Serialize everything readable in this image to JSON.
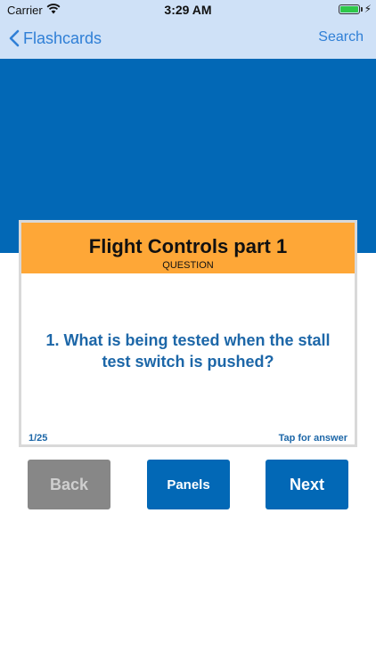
{
  "status_bar": {
    "carrier": "Carrier",
    "time": "3:29 AM",
    "battery_level": 1.0
  },
  "nav": {
    "back_label": "Flashcards",
    "search_label": "Search"
  },
  "card": {
    "title": "Flight Controls part 1",
    "subtitle": "QUESTION",
    "question": "1. What is being tested when the stall test switch is pushed?",
    "counter": "1/25",
    "tap_hint": "Tap for answer"
  },
  "buttons": {
    "back": "Back",
    "panels": "Panels",
    "next": "Next"
  },
  "icons": {
    "back": "chevron-left-icon",
    "wifi": "wifi-icon",
    "battery": "battery-icon",
    "charging": "bolt-icon"
  },
  "colors": {
    "nav_bg": "#cfe1f7",
    "accent": "#0268b6",
    "card_header": "#fea737",
    "question_text": "#1d67a8",
    "disabled_button": "#878787"
  }
}
